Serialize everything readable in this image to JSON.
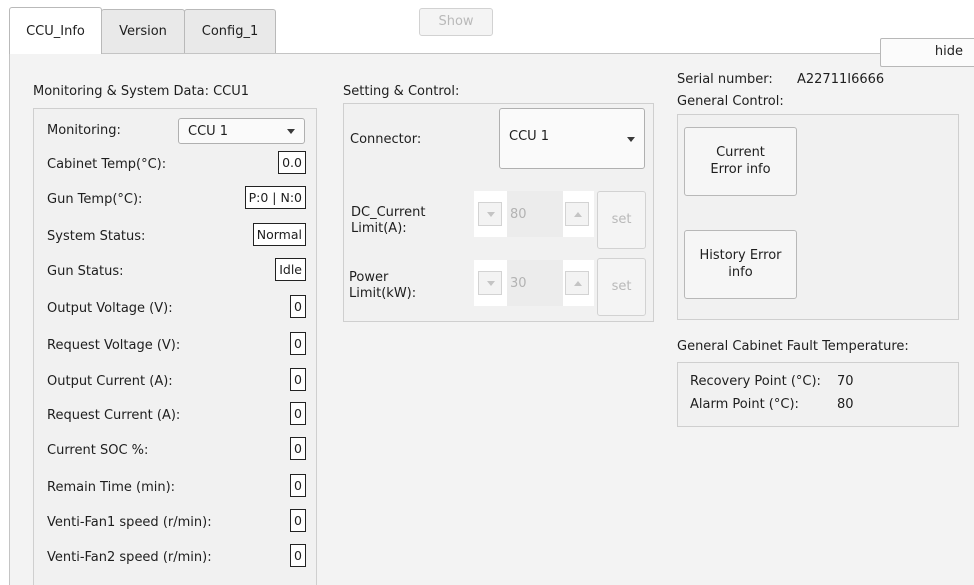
{
  "tabs": [
    {
      "label": "CCU_Info",
      "active": true
    },
    {
      "label": "Version",
      "active": false
    },
    {
      "label": "Config_1",
      "active": false
    }
  ],
  "toolbar": {
    "show_label": "Show",
    "hide_label": "hide"
  },
  "monitoring": {
    "title": "Monitoring & System Data: CCU1",
    "selector_label": "Monitoring:",
    "selector_value": "CCU 1",
    "rows": [
      {
        "label": "Cabinet Temp(°C):",
        "value": "0.0"
      },
      {
        "label": "Gun Temp(°C):",
        "value": "P:0 | N:0"
      },
      {
        "label": "System Status:",
        "value": "Normal"
      },
      {
        "label": "Gun Status:",
        "value": "Idle"
      },
      {
        "label": "Output Voltage (V):",
        "value": "0"
      },
      {
        "label": "Request Voltage (V):",
        "value": "0"
      },
      {
        "label": "Output Current (A):",
        "value": "0"
      },
      {
        "label": "Request Current (A):",
        "value": "0"
      },
      {
        "label": "Current SOC %:",
        "value": "0"
      },
      {
        "label": "Remain Time (min):",
        "value": "0"
      },
      {
        "label": "Venti-Fan1 speed (r/min):",
        "value": "0"
      },
      {
        "label": "Venti-Fan2 speed (r/min):",
        "value": "0"
      }
    ]
  },
  "setting": {
    "title": "Setting & Control:",
    "connector_label": "Connector:",
    "connector_value": "CCU 1",
    "dc_current_label": "DC_Current Limit(A):",
    "dc_current_value": "80",
    "power_label": "Power Limit(kW):",
    "power_value": "30",
    "set_label": "set"
  },
  "serial": {
    "label": "Serial number:",
    "value": "A22711I6666"
  },
  "general_control": {
    "title": "General Control:",
    "current_error_label": "Current Error info",
    "history_error_label": "History Error info"
  },
  "fault_temp": {
    "title": "General Cabinet Fault Temperature:",
    "recovery_label": "Recovery Point (°C):",
    "recovery_value": "70",
    "alarm_label": "Alarm Point (°C):",
    "alarm_value": "80"
  }
}
